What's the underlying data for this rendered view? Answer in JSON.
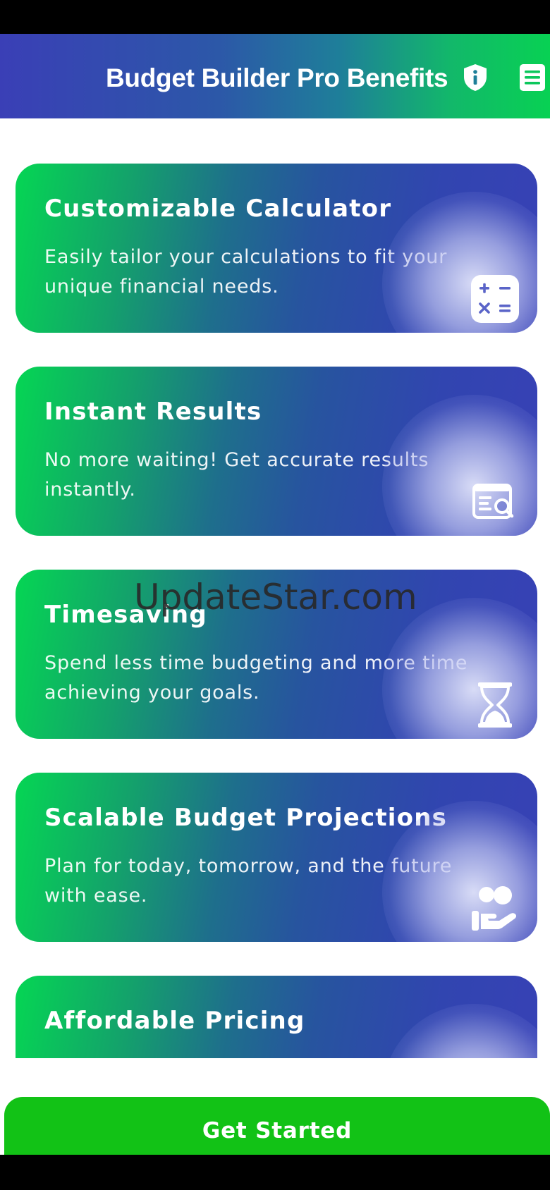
{
  "header": {
    "title": "Budget Builder Pro Benefits",
    "icons": [
      "shield-info-icon",
      "menu-document-icon"
    ]
  },
  "benefits": [
    {
      "title": "Customizable Calculator",
      "description": "Easily tailor your calculations to fit your unique financial needs.",
      "icon": "calculator-icon"
    },
    {
      "title": "Instant Results",
      "description": "No more waiting! Get accurate results instantly.",
      "icon": "results-search-icon"
    },
    {
      "title": "Timesaving",
      "description": "Spend less time budgeting and more time achieving your goals.",
      "icon": "hourglass-icon"
    },
    {
      "title": "Scalable Budget Projections",
      "description": "Plan for today, tomorrow, and the future with ease.",
      "icon": "hand-coins-icon"
    },
    {
      "title": "Affordable Pricing",
      "description": "",
      "icon": ""
    }
  ],
  "watermark": "UpdateStar.com",
  "cta": {
    "label": "Get Started"
  },
  "colors": {
    "cta": "#12c216",
    "gradient_green": "#05d653",
    "gradient_blue": "#3841b6"
  }
}
